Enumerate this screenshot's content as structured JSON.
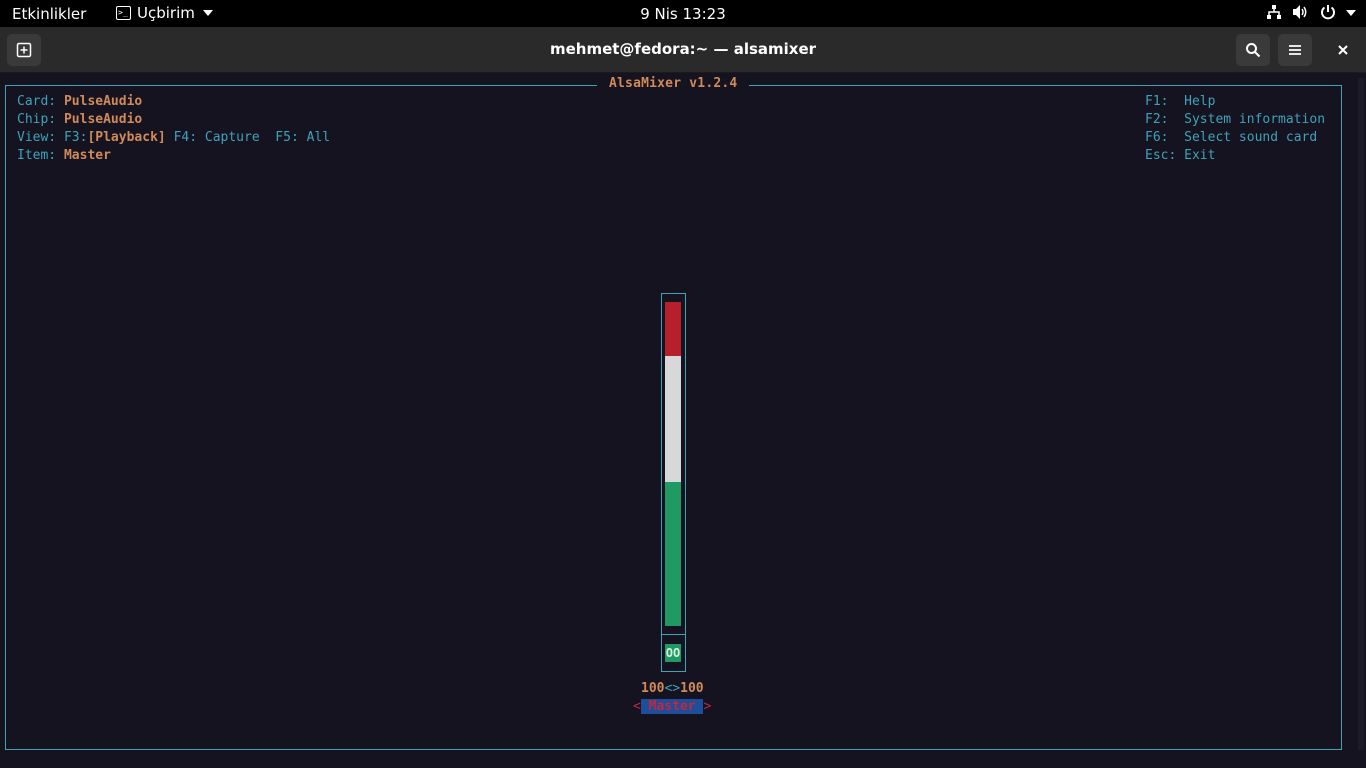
{
  "topbar": {
    "activities": "Etkinlikler",
    "app_name": "Uçbirim",
    "clock": "9 Nis  13:23",
    "tray_icons": [
      "network-icon",
      "volume-icon",
      "power-icon"
    ]
  },
  "window": {
    "title": "mehmet@fedora:~ — alsamixer",
    "buttons": [
      "new-tab-icon",
      "search-icon",
      "menu-icon",
      "close-icon"
    ]
  },
  "alsamixer": {
    "title": "AlsaMixer v1.2.4",
    "card_label": "Card:",
    "card_value": "PulseAudio",
    "chip_label": "Chip:",
    "chip_value": "PulseAudio",
    "view_label": "View:",
    "view_f3": "F3:",
    "view_playback": "[Playback]",
    "view_f4": "F4: Capture  F5: All",
    "item_label": "Item:",
    "item_value": "Master",
    "help": [
      {
        "key": "F1:",
        "desc": "Help"
      },
      {
        "key": "F2:",
        "desc": "System information"
      },
      {
        "key": "F6:",
        "desc": "Select sound card"
      },
      {
        "key": "Esc:",
        "desc": "Exit"
      }
    ],
    "control": {
      "name": "Master",
      "left_volume": "100",
      "separator": "<>",
      "right_volume": "100",
      "level": 1.0,
      "mute_state": "OO",
      "arrow_left": "<",
      "arrow_right": ">"
    }
  },
  "colors": {
    "accent_cyan": "#3ea2b8",
    "accent_orange": "#d08a5a",
    "bar_red": "#b81f2c",
    "bar_white": "#d8d8d8",
    "bar_green": "#1f9a63",
    "selected_bg": "#1e4d9a"
  }
}
